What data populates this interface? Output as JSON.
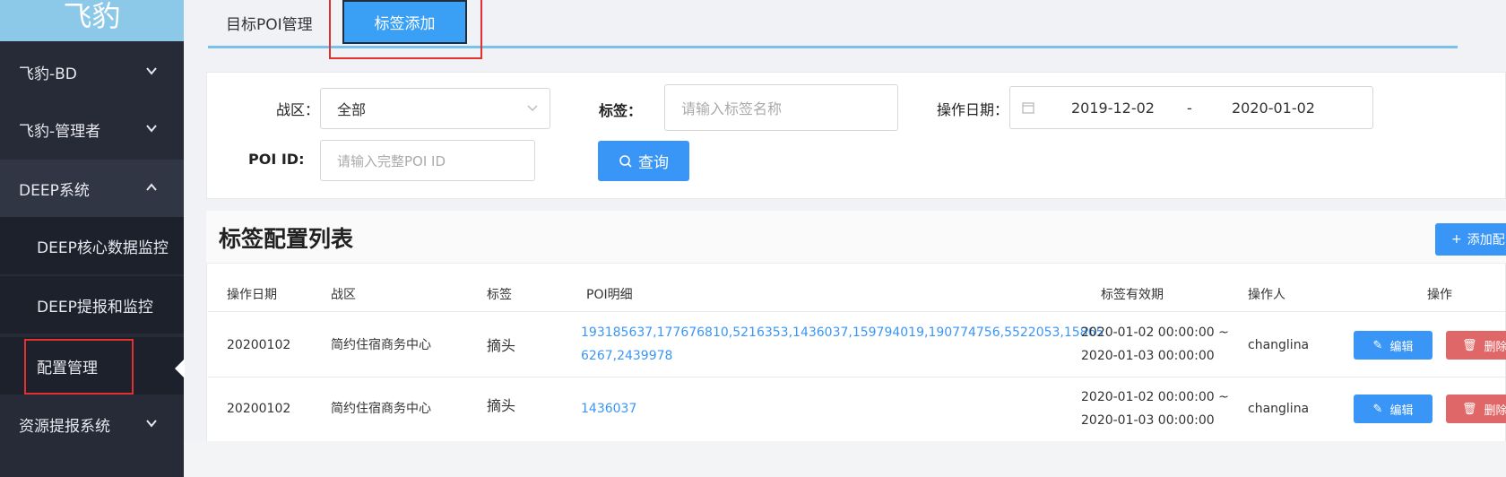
{
  "sidebar": {
    "logo": "飞豹",
    "items": [
      {
        "label": "飞豹-BD"
      },
      {
        "label": "飞豹-管理者"
      },
      {
        "label": "DEEP系统"
      },
      {
        "label": "DEEP核心数据监控"
      },
      {
        "label": "DEEP提报和监控"
      },
      {
        "label": "配置管理"
      },
      {
        "label": "资源提报系统"
      }
    ]
  },
  "tabs": {
    "poi_management": "目标POI管理",
    "tag_add": "标签添加"
  },
  "filters": {
    "zone_label": "战区：",
    "zone_value": "全部",
    "tag_label": "标签：",
    "tag_placeholder": "请输入标签名称",
    "date_label": "操作日期：",
    "date_start": "2019-12-02",
    "date_sep": "-",
    "date_end": "2020-01-02",
    "poi_label": "POI ID:",
    "poi_placeholder": "请输入完整POI ID",
    "query_button": "查询"
  },
  "list": {
    "title": "标签配置列表",
    "add_button": "添加配",
    "columns": [
      "操作日期",
      "战区",
      "标签",
      "POI明细",
      "标签有效期",
      "操作人",
      "操作"
    ],
    "rows": [
      {
        "date": "20200102",
        "zone": "简约住宿商务中心",
        "tag": "摘头",
        "poi_line1": "193185637,177676810,5216353,1436037,159794019,190774756,5522053,15865",
        "poi_line2": "6267,2439978",
        "valid_from": "2020-01-02 00:00:00 ~",
        "valid_to": "2020-01-03 00:00:00",
        "operator": "changlina",
        "edit": "编辑",
        "delete": "删除"
      },
      {
        "date": "20200102",
        "zone": "简约住宿商务中心",
        "tag": "摘头",
        "poi_line1": "1436037",
        "valid_from": "2020-01-02 00:00:00 ~",
        "valid_to": "2020-01-03 00:00:00",
        "operator": "changlina",
        "edit": "编辑",
        "delete": "删除"
      }
    ]
  },
  "colors": {
    "sidebar_bg": "#262b37",
    "logo_bg": "#8cc8e8",
    "primary": "#3a96f6",
    "danger": "#e06767",
    "highlight_box": "#e0312f"
  }
}
